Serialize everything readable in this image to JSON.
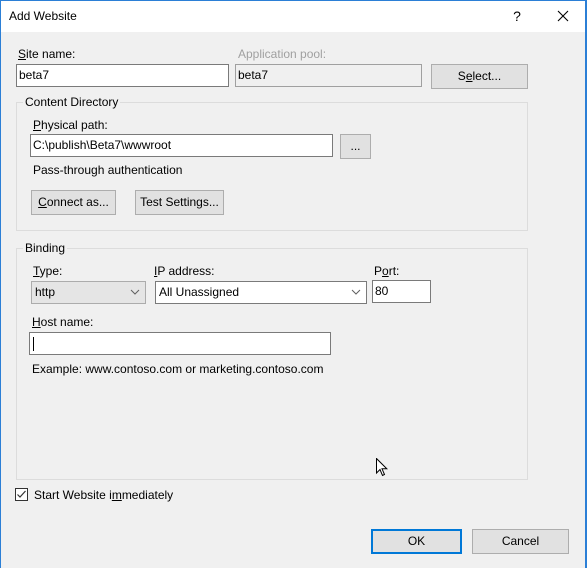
{
  "window": {
    "title": "Add Website",
    "help_label": "?",
    "close_label": "✕"
  },
  "site": {
    "site_name_label": "Site name:",
    "site_name_mnemonic": "S",
    "site_name_rest": "ite name:",
    "site_name_value": "beta7",
    "app_pool_label_a": "Application pool:",
    "app_pool_value": "beta7",
    "select_label_a": "S",
    "select_label_b": "e",
    "select_label_c": "lect..."
  },
  "content_directory": {
    "title": "Content Directory",
    "physical_path_mnemonic": "P",
    "physical_path_rest": "hysical path:",
    "physical_path_value": "C:\\publish\\Beta7\\wwwroot",
    "browse_label": "...",
    "auth_text": "Pass-through authentication",
    "connect_as_mnemonic": "C",
    "connect_as_rest": "onnect as...",
    "test_settings_label_a": "Test Settin",
    "test_settings_label_b": "g",
    "test_settings_label_c": "s..."
  },
  "binding": {
    "title": "Binding",
    "type_mnemonic": "T",
    "type_rest": "ype:",
    "type_value": "http",
    "ip_mnemonic": "I",
    "ip_rest": "P address:",
    "ip_value": "All Unassigned",
    "port_a": "P",
    "port_b": "o",
    "port_c": "rt:",
    "port_value": "80",
    "host_mnemonic": "H",
    "host_rest": "ost name:",
    "host_value": "",
    "example_text": "Example: www.contoso.com or marketing.contoso.com"
  },
  "start_website": {
    "checked": true,
    "label_a": "Start Website i",
    "label_b": "m",
    "label_c": "mediately"
  },
  "footer": {
    "ok_label": "OK",
    "cancel_label": "Cancel"
  },
  "colors": {
    "accent": "#0078d7",
    "window_border": "#2b7fd6"
  }
}
